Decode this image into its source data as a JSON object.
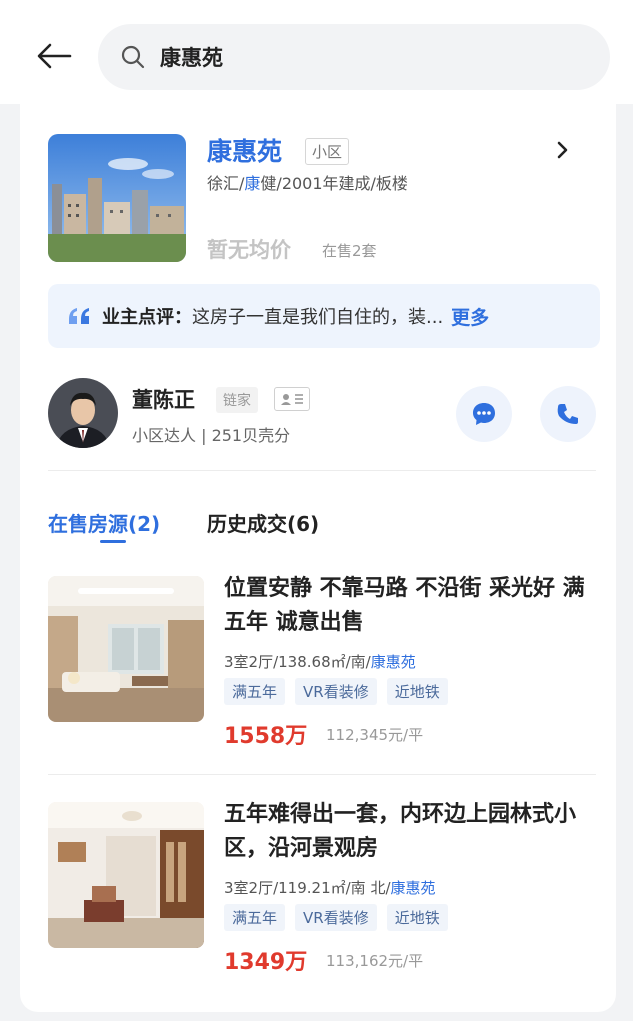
{
  "search": {
    "value": "康惠苑"
  },
  "community": {
    "name": "康惠苑",
    "tag": "小区",
    "meta_prefix": "徐汇/",
    "meta_highlight": "康",
    "meta_suffix": "健/2001年建成/板楼",
    "avg_price": "暂无均价",
    "on_sale": "在售2套"
  },
  "review": {
    "label": "业主点评：",
    "text": "这房子一直是我们自住的，装...",
    "more": "更多"
  },
  "agent": {
    "name": "董陈正",
    "company": "链家",
    "meta": "小区达人 | 251贝壳分"
  },
  "tabs": {
    "active": "在售房源(2)",
    "inactive": "历史成交(6)"
  },
  "listings": [
    {
      "title": "位置安静 不靠马路 不沿街 采光好 满五年 诚意出售",
      "meta_prefix": "3室2厅/138.68㎡/南/",
      "meta_community": "康惠苑",
      "tags": [
        "满五年",
        "VR看装修",
        "近地铁"
      ],
      "price": "1558万",
      "unit_price": "112,345元/平"
    },
    {
      "title": "五年难得出一套，内环边上园林式小区，沿河景观房",
      "meta_prefix": "3室2厅/119.21㎡/南 北/",
      "meta_community": "康惠苑",
      "tags": [
        "满五年",
        "VR看装修",
        "近地铁"
      ],
      "price": "1349万",
      "unit_price": "113,162元/平"
    }
  ],
  "colors": {
    "accent": "#2f6fde",
    "price": "#e03a2d"
  }
}
